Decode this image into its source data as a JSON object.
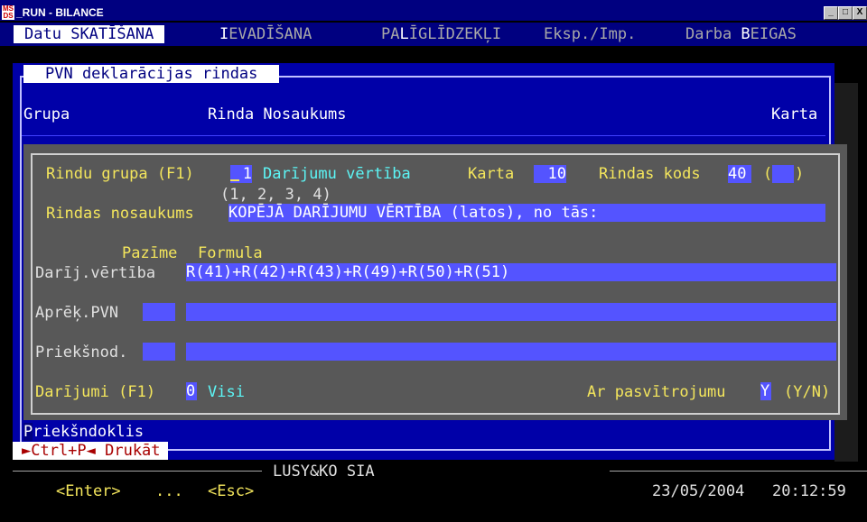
{
  "window": {
    "icon_text": "MS\nDS",
    "title": "_RUN - BILANCE",
    "btn_min": "_",
    "btn_max": "□",
    "btn_close": "X"
  },
  "menu": {
    "items": [
      {
        "pre": "Datu ",
        "hot": "S",
        "post": "KATĪŠANA"
      },
      {
        "pre": "",
        "hot": "I",
        "post": "EVADĪŠANA"
      },
      {
        "pre": "PA",
        "hot": "L",
        "post": "ĪGLĪDZEKĻI"
      },
      {
        "pre": "",
        "hot": "",
        "post": "Eksp./Imp."
      },
      {
        "pre": "Darba ",
        "hot": "B",
        "post": "EIGAS"
      }
    ]
  },
  "panel": {
    "title": "PVN deklarācijas rindas",
    "col_group": "Grupa",
    "col_row_name": "Rinda Nosaukums",
    "col_karta": "Karta",
    "prefix_label_first": "P",
    "prefix_label_rest": "riekšndoklis"
  },
  "dialog": {
    "group_label": "Rindu grupa (F1)",
    "group_value": "1",
    "group_name": "Darījumu vērtība",
    "karta_label": "Karta",
    "karta_value": "10",
    "code_label": "Rindas kods",
    "code_value": "40",
    "paren_open": "(",
    "paren_close": ")",
    "group_options": "(1, 2, 3, 4)",
    "name_label": "Rindas nosaukums",
    "name_value": "KOPĒJĀ DARĪJUMU VĒRTĪBA (latos), no tās:",
    "hdr_sign": "Pazīme",
    "hdr_formula": "Formula",
    "rows": [
      {
        "label": "Darīj.vērtība",
        "sign": "",
        "formula": "R(41)+R(42)+R(43)+R(49)+R(50)+R(51)"
      },
      {
        "label": "Aprēķ.PVN",
        "sign": "",
        "formula": ""
      },
      {
        "label": "Priekšnod.",
        "sign": "",
        "formula": ""
      }
    ],
    "deals_label": "Darījumi (F1)",
    "deals_value": "0",
    "deals_name": "Visi",
    "underline_label": "Ar pasvītrojumu",
    "underline_value": "Y",
    "underline_hint": "(Y/N)"
  },
  "footer": {
    "ctrlp_label": "►Ctrl+P◄ Drukāt",
    "company": "LUSY&KO SIA",
    "enter_hint": "<Enter>",
    "dots": "...",
    "esc_hint": "<Esc>",
    "date": "23/05/2004",
    "time": "20:12:59"
  },
  "colors": {
    "console_bg": "#000000",
    "menu_bg": "#000080",
    "panel_bg": "#0000a8",
    "dialog_bg": "#585858",
    "field_bg": "#5454ff",
    "label_yellow": "#f4e65c",
    "value_cyan": "#5cf6f6"
  }
}
